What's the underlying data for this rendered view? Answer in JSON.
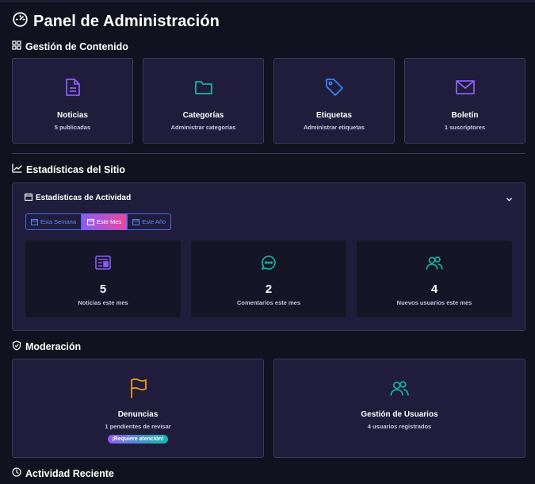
{
  "header": {
    "title": "Panel de Administración"
  },
  "sections": {
    "content": "Gestión de Contenido",
    "stats": "Estadísticas del Sitio",
    "moderation": "Moderación",
    "recent": "Actividad Reciente"
  },
  "content_cards": [
    {
      "label": "Noticias",
      "sub": "5 publicadas",
      "icon": "document-icon",
      "color": "#8b5cf6"
    },
    {
      "label": "Categorías",
      "sub": "Administrar categorías",
      "icon": "folder-icon",
      "color": "#14b8a6"
    },
    {
      "label": "Etiquetas",
      "sub": "Administrar etiquetas",
      "icon": "tag-icon",
      "color": "#3b82f6"
    },
    {
      "label": "Boletín",
      "sub": "1 suscriptores",
      "icon": "envelope-icon",
      "color": "#8b5cf6"
    }
  ],
  "activity": {
    "title": "Estadísticas de Actividad",
    "periods": [
      "Esta Semana",
      "Este Mes",
      "Este Año"
    ],
    "selected_period": "Este Mes",
    "stats": [
      {
        "value": "5",
        "label": "Noticias este mes",
        "icon": "newspaper-icon",
        "color": "#8b5cf6"
      },
      {
        "value": "2",
        "label": "Comentarios este mes",
        "icon": "chat-icon",
        "color": "#14b8a6"
      },
      {
        "value": "4",
        "label": "Nuevos usuarios este mes",
        "icon": "users-icon",
        "color": "#14b8a6"
      }
    ]
  },
  "moderation_cards": [
    {
      "label": "Denuncias",
      "sub": "1 pendientes de revisar",
      "badge": "¡Requiere atención!",
      "icon": "flag-icon",
      "color": "#f59e0b"
    },
    {
      "label": "Gestión de Usuarios",
      "sub": "4 usuarios registrados",
      "icon": "users-icon",
      "color": "#14b8a6"
    }
  ]
}
